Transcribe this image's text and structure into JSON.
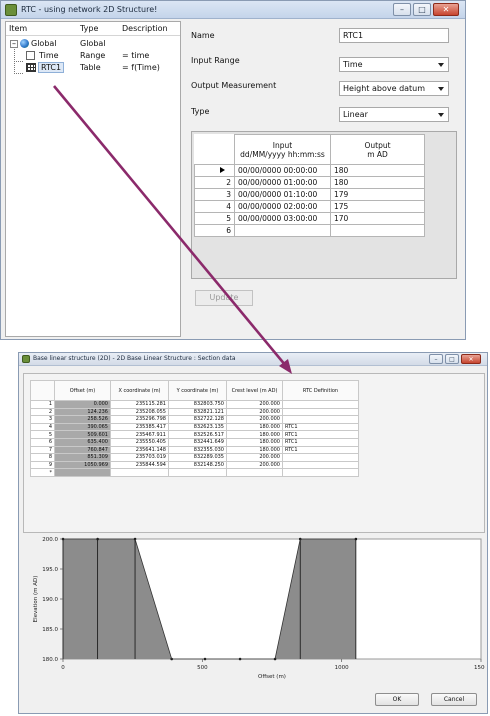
{
  "rtc_window": {
    "title": "RTC -  using network 2D Structure!",
    "controls": {
      "minimize": "–",
      "maximize": "□",
      "close": "✕"
    },
    "tree": {
      "headers": {
        "item": "Item",
        "type": "Type",
        "description": "Description"
      },
      "rows": [
        {
          "item": "Global",
          "type": "Global",
          "description": ""
        },
        {
          "item": "Time",
          "type": "Range",
          "description": "= time"
        },
        {
          "item": "RTC1",
          "type": "Table",
          "description": "= f(Time)"
        }
      ],
      "expander": "–"
    },
    "properties": {
      "name_label": "Name",
      "name_value": "RTC1",
      "input_range_label": "Input Range",
      "input_range_value": "Time",
      "output_measurement_label": "Output Measurement",
      "output_measurement_value": "Height above datum",
      "type_label": "Type",
      "type_value": "Linear"
    },
    "rtc_table": {
      "input_header": "Input",
      "input_subheader": "dd/MM/yyyy hh:mm:ss",
      "output_header": "Output",
      "output_subheader": "m AD",
      "rows": [
        {
          "num": "1",
          "input": "00/00/0000 00:00:00",
          "output": "180"
        },
        {
          "num": "2",
          "input": "00/00/0000 01:00:00",
          "output": "180"
        },
        {
          "num": "3",
          "input": "00/00/0000 01:10:00",
          "output": "179"
        },
        {
          "num": "4",
          "input": "00/00/0000 02:00:00",
          "output": "175"
        },
        {
          "num": "5",
          "input": "00/00/0000 03:00:00",
          "output": "170"
        },
        {
          "num": "6",
          "input": "",
          "output": ""
        }
      ]
    },
    "update_button": "Update"
  },
  "section_window": {
    "title": "Base linear structure (2D) - 2D Base Linear Structure : Section data",
    "table": {
      "headers": [
        "Offset (m)",
        "X coordinate (m)",
        "Y coordinate (m)",
        "Crest level (m AD)",
        "RTC Definition"
      ],
      "rows": [
        {
          "num": "1",
          "offset": "0.000",
          "x": "235115.281",
          "y": "832803.750",
          "crest": "200.000",
          "rtc": ""
        },
        {
          "num": "2",
          "offset": "124.236",
          "x": "235208.055",
          "y": "832821.121",
          "crest": "200.000",
          "rtc": ""
        },
        {
          "num": "3",
          "offset": "258.526",
          "x": "235296.798",
          "y": "832722.128",
          "crest": "200.000",
          "rtc": ""
        },
        {
          "num": "4",
          "offset": "390.065",
          "x": "235385.417",
          "y": "832623.135",
          "crest": "180.000",
          "rtc": "RTC1"
        },
        {
          "num": "5",
          "offset": "509.601",
          "x": "235467.911",
          "y": "832526.517",
          "crest": "180.000",
          "rtc": "RTC1"
        },
        {
          "num": "6",
          "offset": "635.400",
          "x": "235550.405",
          "y": "832441.649",
          "crest": "180.000",
          "rtc": "RTC1"
        },
        {
          "num": "7",
          "offset": "760.847",
          "x": "235641.148",
          "y": "832355.030",
          "crest": "180.000",
          "rtc": "RTC1"
        },
        {
          "num": "8",
          "offset": "851.309",
          "x": "235703.019",
          "y": "832289.035",
          "crest": "200.000",
          "rtc": ""
        },
        {
          "num": "9",
          "offset": "1050.969",
          "x": "235844.594",
          "y": "832148.250",
          "crest": "200.000",
          "rtc": ""
        },
        {
          "num": "*",
          "offset": "",
          "x": "",
          "y": "",
          "crest": "",
          "rtc": ""
        }
      ]
    },
    "ok_button": "OK",
    "cancel_button": "Cancel"
  },
  "colors": {
    "arrow": "#8b2a6b",
    "fill": "#8c8c8c",
    "window_border": "#8a9bb3"
  },
  "chart_data": {
    "type": "area",
    "xlabel": "Offset (m)",
    "ylabel": "Elevation (m AD)",
    "xlim": [
      0,
      1500
    ],
    "ylim": [
      180,
      200
    ],
    "xticks": [
      0,
      500,
      1000,
      1500
    ],
    "yticks": [
      180.0,
      185.0,
      190.0,
      195.0,
      200.0
    ],
    "x": [
      0,
      124.236,
      258.526,
      390.065,
      509.601,
      635.4,
      760.847,
      851.309,
      1050.969
    ],
    "y": [
      200,
      200,
      200,
      180,
      180,
      180,
      180,
      200,
      200
    ],
    "grid": false
  }
}
